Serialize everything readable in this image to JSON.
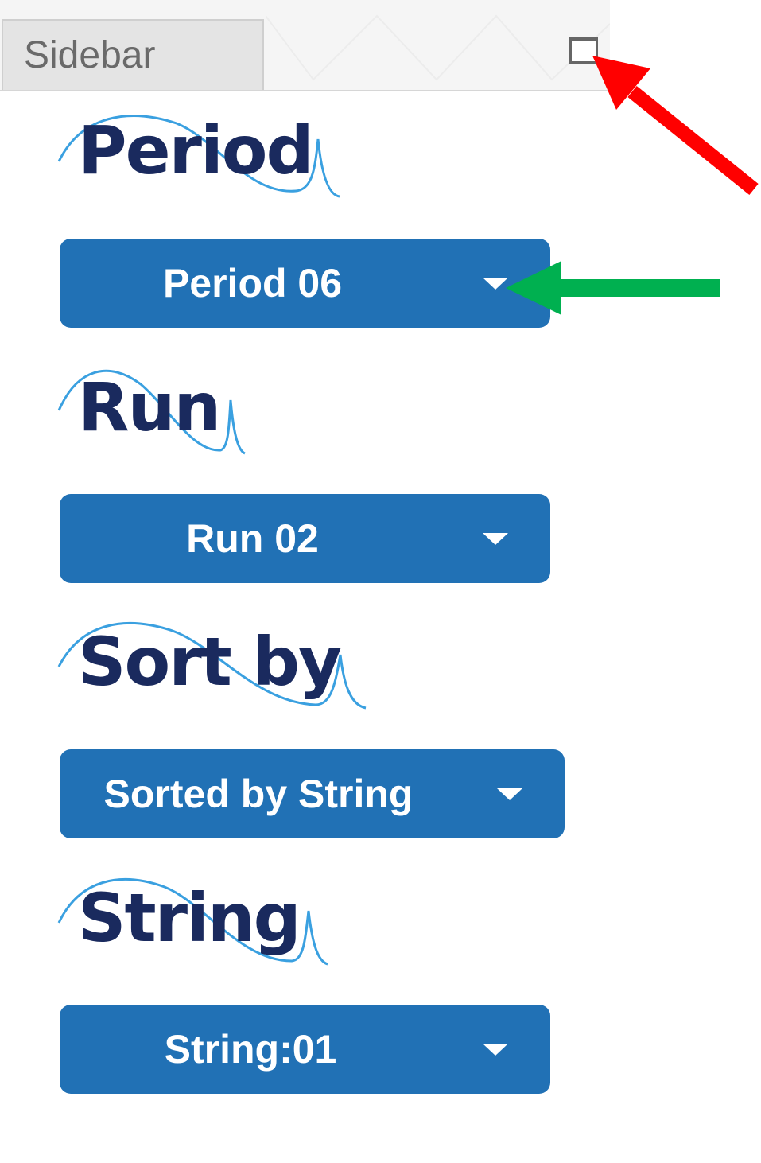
{
  "sidebar_tab": {
    "label": "Sidebar"
  },
  "maximize_button": {
    "icon": "window-maximize-icon"
  },
  "sections": [
    {
      "heading": "Period",
      "selected": "Period 06"
    },
    {
      "heading": "Run",
      "selected": "Run 02"
    },
    {
      "heading": "Sort by",
      "selected": "Sorted by String"
    },
    {
      "heading": "String",
      "selected": "String:01"
    }
  ],
  "colors": {
    "dropdown_bg": "#2171b5",
    "heading_text": "#1a2a5e",
    "swoosh": "#3aa0e0",
    "annotation_red": "#ff0000",
    "annotation_green": "#00b050"
  }
}
